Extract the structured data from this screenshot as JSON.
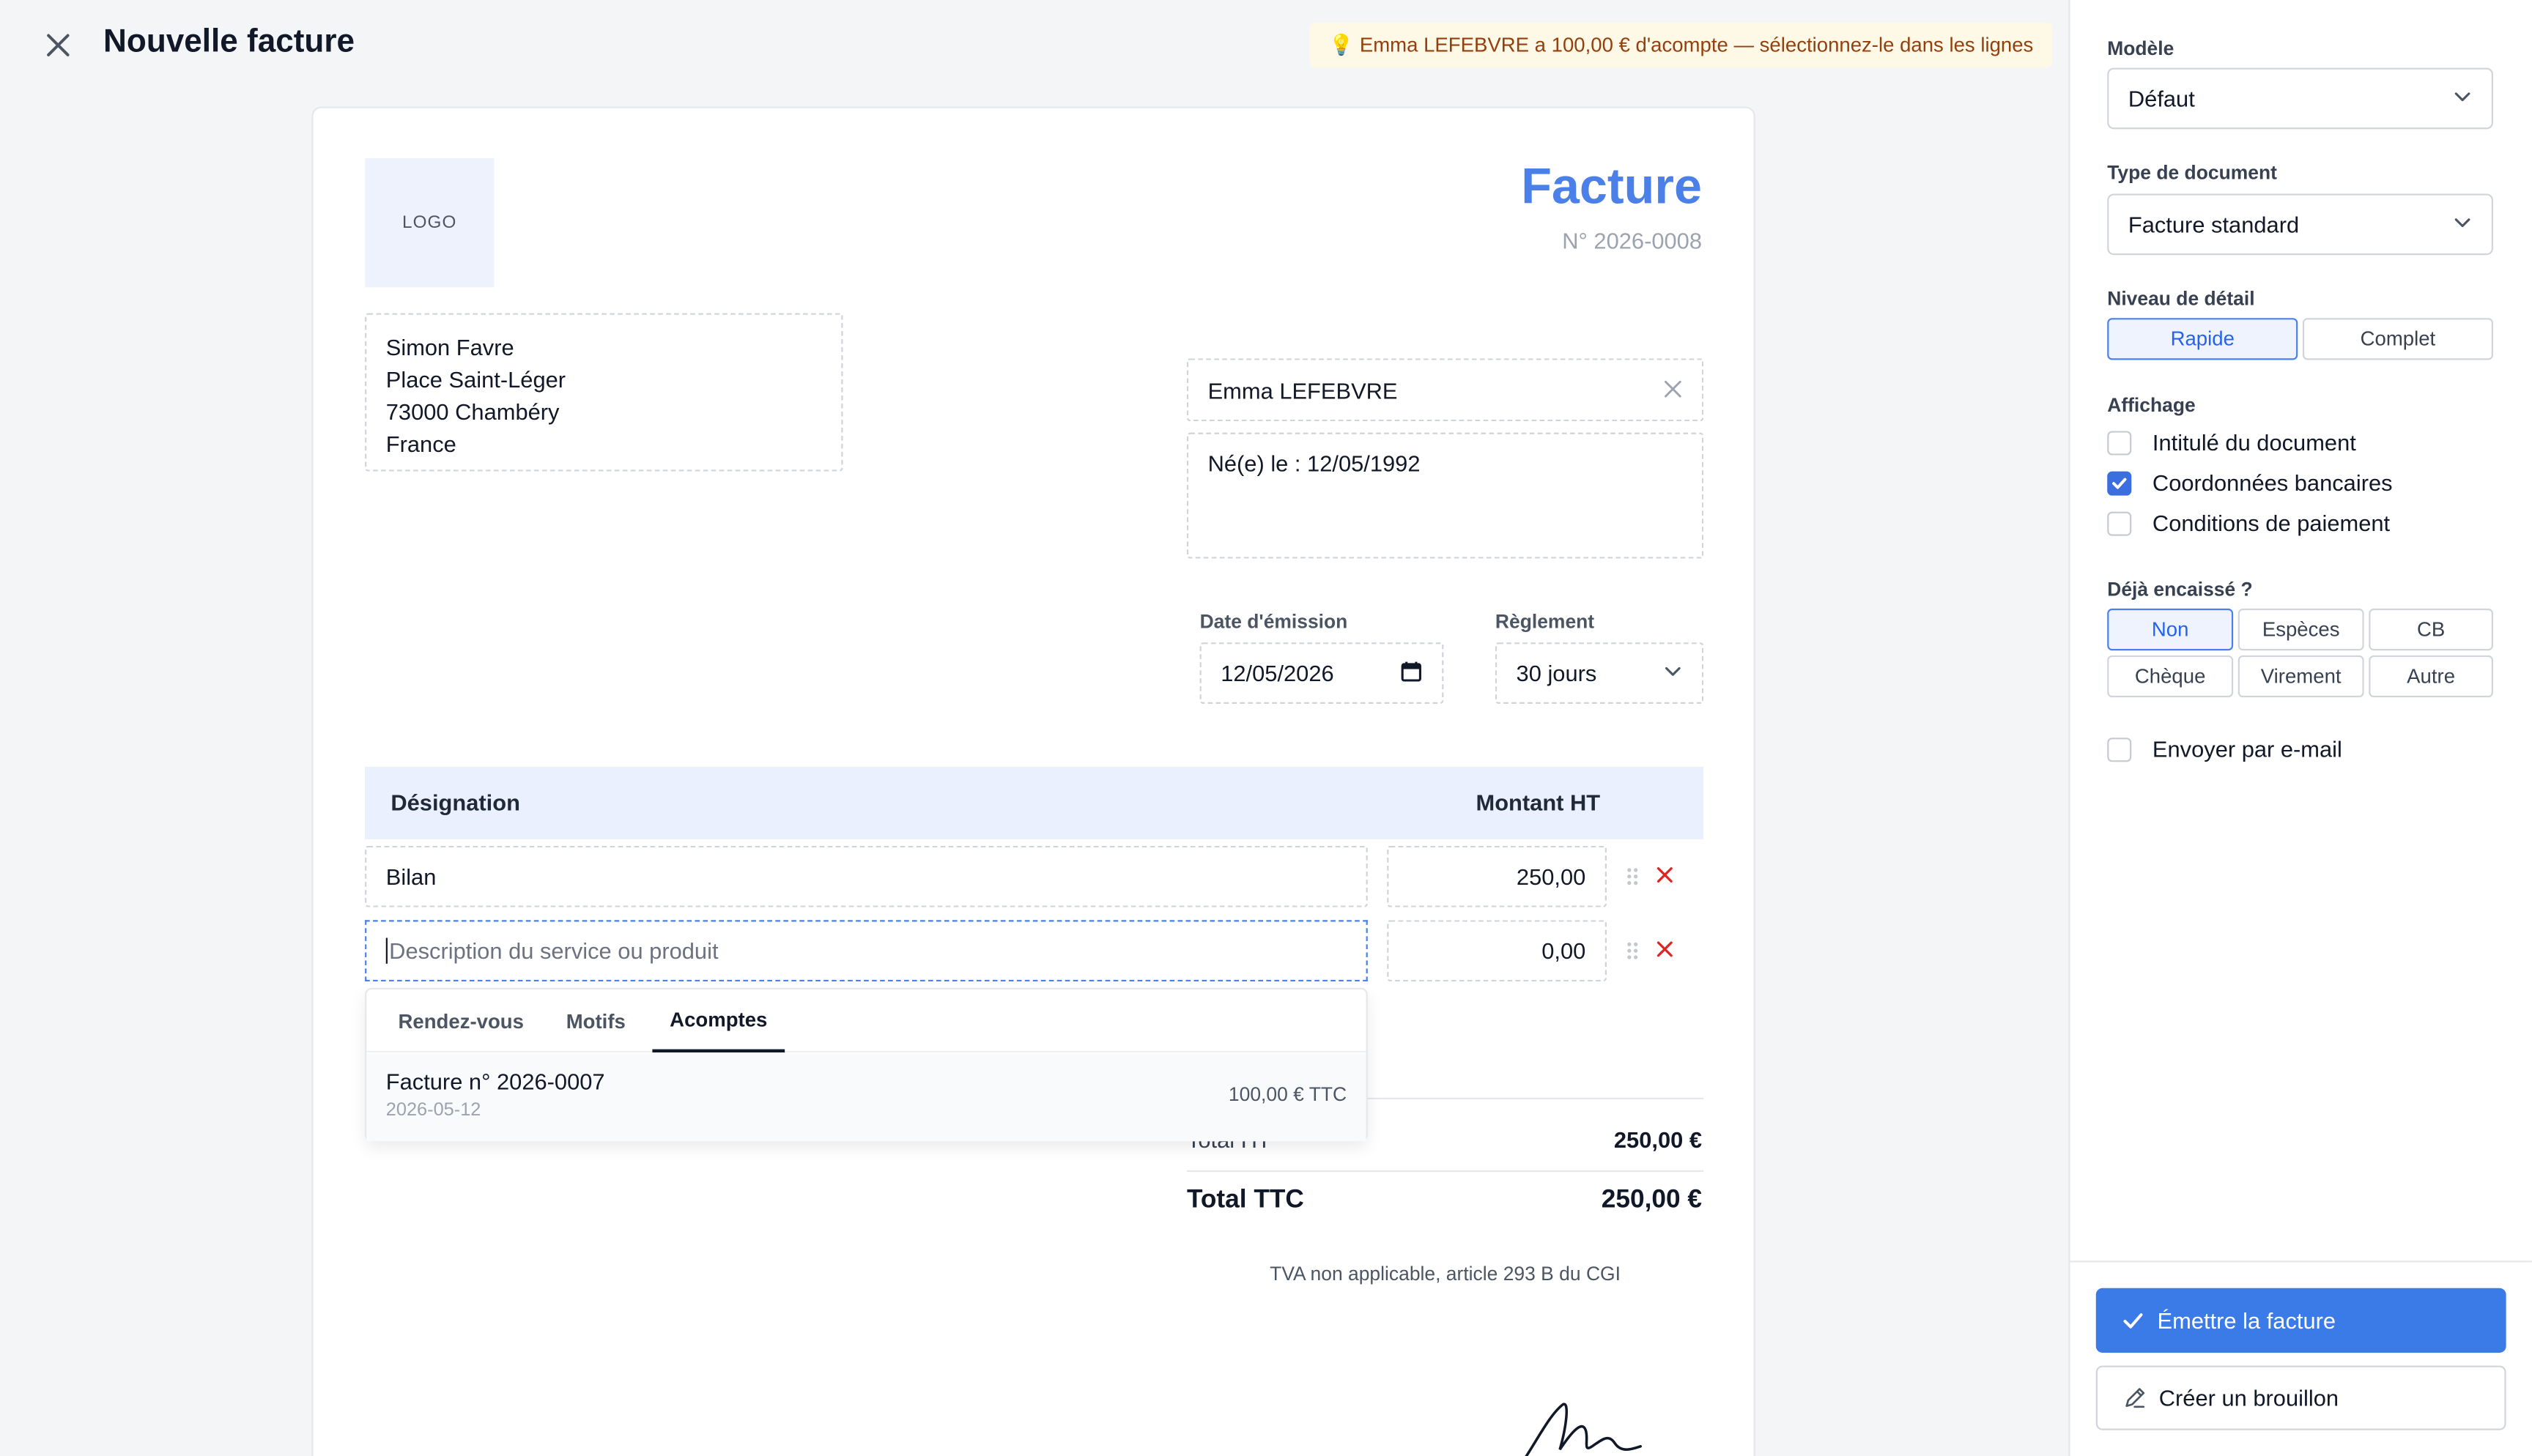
{
  "header": {
    "title": "Nouvelle facture",
    "hint_icon": "lightbulb-icon",
    "hint": "💡 Emma LEFEBVRE a 100,00 € d'acompte — sélectionnez-le dans les lignes"
  },
  "document": {
    "logo_text": "LOGO",
    "title": "Facture",
    "number": "N° 2026-0008",
    "issuer": {
      "name": "Simon Favre",
      "street": "Place Saint-Léger",
      "city": "73000 Chambéry",
      "country": "France"
    },
    "client": {
      "name": "Emma LEFEBVRE",
      "details": "Né(e) le : 12/05/1992"
    },
    "date_label": "Date d'émission",
    "date_value": "12/05/2026",
    "reglement_label": "Règlement",
    "reglement_value": "30 jours",
    "table": {
      "col_designation": "Désignation",
      "col_montant": "Montant HT",
      "lines": [
        {
          "designation": "Bilan",
          "montant": "250,00"
        },
        {
          "designation": "",
          "placeholder": "Description du service ou produit",
          "montant": "0,00"
        }
      ]
    },
    "totals": {
      "ht_label": "Total HT",
      "ht_value": "250,00 €",
      "ttc_label": "Total TTC",
      "ttc_value": "250,00 €",
      "tva_note": "TVA non applicable, article 293 B du CGI"
    }
  },
  "dropdown": {
    "tabs": [
      "Rendez-vous",
      "Motifs",
      "Acomptes"
    ],
    "active_tab": "Acomptes",
    "items": [
      {
        "title": "Facture n° 2026-0007",
        "date": "2026-05-12",
        "amount": "100,00 € TTC"
      }
    ]
  },
  "sidebar": {
    "modele_label": "Modèle",
    "modele_value": "Défaut",
    "type_label": "Type de document",
    "type_value": "Facture standard",
    "niveau_label": "Niveau de détail",
    "niveau_options": [
      "Rapide",
      "Complet"
    ],
    "niveau_selected": "Rapide",
    "affichage_label": "Affichage",
    "affichage_options": [
      {
        "label": "Intitulé du document",
        "checked": false
      },
      {
        "label": "Coordonnées bancaires",
        "checked": true
      },
      {
        "label": "Conditions de paiement",
        "checked": false
      }
    ],
    "encaisse_label": "Déjà encaissé ?",
    "encaisse_options": [
      "Non",
      "Espèces",
      "CB",
      "Chèque",
      "Virement",
      "Autre"
    ],
    "encaisse_selected": "Non",
    "email_label": "Envoyer par e-mail",
    "email_checked": false,
    "emit_label": "Émettre la facture",
    "draft_label": "Créer un brouillon"
  },
  "colors": {
    "accent": "#3b7be8",
    "title_blue": "#4a80e8",
    "header_row": "#eaf0fd",
    "hint_bg": "#fef9e7",
    "hint_text": "#92400e",
    "delete_red": "#dc2626"
  }
}
